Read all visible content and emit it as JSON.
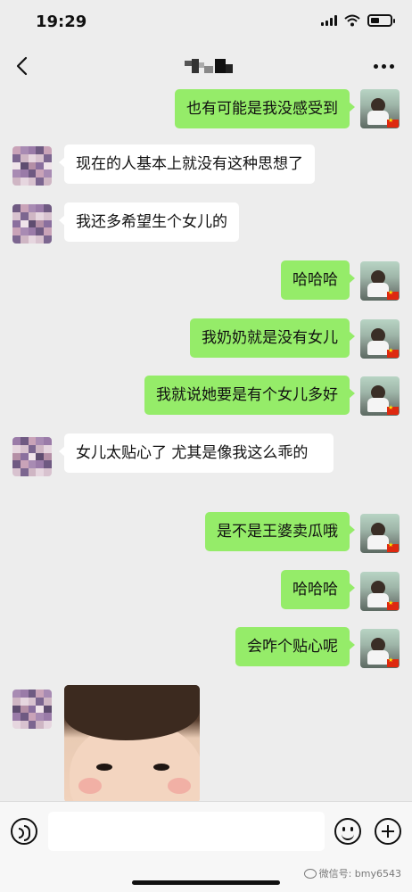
{
  "status_bar": {
    "time": "19:29",
    "battery_level_pct": 45,
    "icons": [
      "signal-icon",
      "wifi-icon",
      "battery-icon"
    ]
  },
  "nav_bar": {
    "back_icon": "chevron-left-icon",
    "contact_name_pixelated": true,
    "more_icon": "more-dots-icon"
  },
  "messages": [
    {
      "side": "right",
      "text": "也有可能是我没感受到"
    },
    {
      "side": "left",
      "text": "现在的人基本上就没有这种思想了"
    },
    {
      "side": "left",
      "text": "我还多希望生个女儿的"
    },
    {
      "side": "right",
      "text": "哈哈哈"
    },
    {
      "side": "right",
      "text": "我奶奶就是没有女儿"
    },
    {
      "side": "right",
      "text": "我就说她要是有个女儿多好"
    },
    {
      "side": "left",
      "text": "女儿太贴心了 尤其是像我这么乖的"
    },
    {
      "side": "right",
      "text": "是不是王婆卖瓜哦"
    },
    {
      "side": "right",
      "text": "哈哈哈"
    },
    {
      "side": "right",
      "text": "会咋个贴心呢"
    },
    {
      "side": "left",
      "type": "image",
      "content": "baby-photo"
    }
  ],
  "input_bar": {
    "voice_icon": "voice-icon",
    "emoji_icon": "emoji-icon",
    "plus_icon": "plus-icon",
    "placeholder": ""
  },
  "watermark": "微信号: bmy6543",
  "colors": {
    "background": "#ededed",
    "bubble_right": "#95ec69",
    "bubble_left": "#ffffff"
  }
}
